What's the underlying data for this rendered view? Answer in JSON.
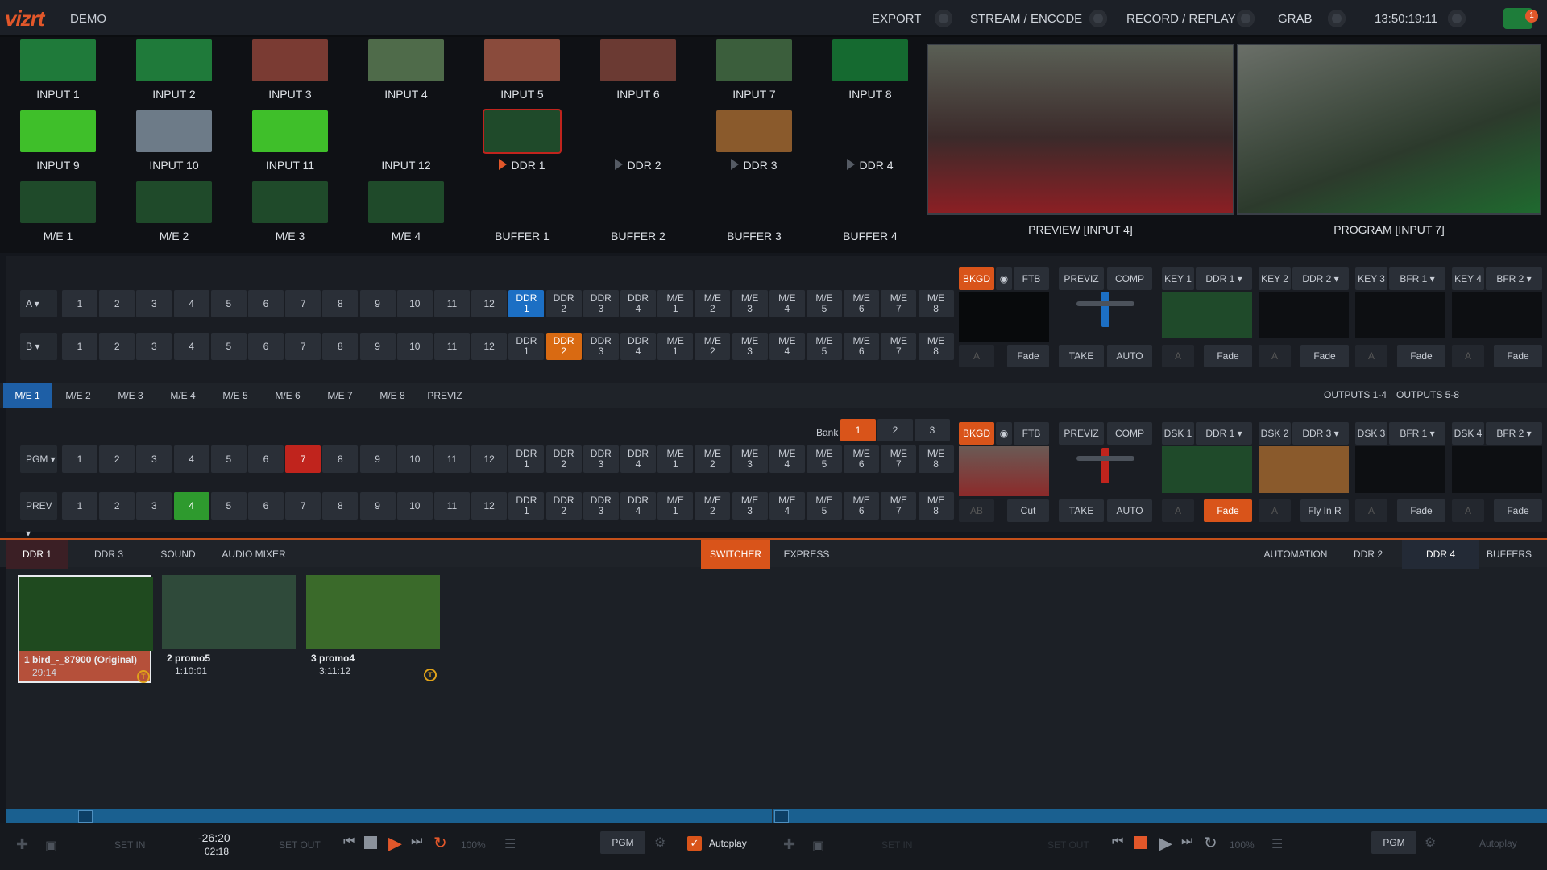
{
  "topbar": {
    "logo": "vizrt",
    "session_name": "DEMO",
    "menu": [
      "EXPORT",
      "STREAM / ENCODE",
      "RECORD / REPLAY",
      "GRAB"
    ],
    "clock": "13:50:19:11",
    "notification_count": "1"
  },
  "sources": [
    {
      "label": "INPUT 1",
      "color": "#1f7a3a"
    },
    {
      "label": "INPUT 2",
      "color": "#1f7a3a"
    },
    {
      "label": "INPUT 3",
      "color": "#7a3b33"
    },
    {
      "label": "INPUT 4",
      "color": "#4f6b4a"
    },
    {
      "label": "INPUT 5",
      "color": "#8a4b3c"
    },
    {
      "label": "INPUT 6",
      "color": "#6b3a33"
    },
    {
      "label": "INPUT 7",
      "color": "#3b5e3c"
    },
    {
      "label": "INPUT 8",
      "color": "#156a30"
    },
    {
      "label": "INPUT 9",
      "color": "#3fbf2a"
    },
    {
      "label": "INPUT 10",
      "color": "#6d7b88"
    },
    {
      "label": "INPUT 11",
      "color": "#3fbf2a"
    },
    {
      "label": "INPUT 12",
      "color": ""
    },
    {
      "label": "DDR 1",
      "color": "#1f4a2a",
      "play": true,
      "active": true
    },
    {
      "label": "DDR 2",
      "color": "",
      "play": true
    },
    {
      "label": "DDR 3",
      "color": "#8a5a2c",
      "play": true
    },
    {
      "label": "DDR 4",
      "color": "",
      "play": true
    },
    {
      "label": "M/E 1",
      "color": "#1f4a2a"
    },
    {
      "label": "M/E 2",
      "color": "#1f4a2a"
    },
    {
      "label": "M/E 3",
      "color": "#1f4a2a"
    },
    {
      "label": "M/E 4",
      "color": "#1f4a2a"
    },
    {
      "label": "BUFFER 1",
      "color": ""
    },
    {
      "label": "BUFFER 2",
      "color": ""
    },
    {
      "label": "BUFFER 3",
      "color": ""
    },
    {
      "label": "BUFFER 4",
      "color": ""
    }
  ],
  "monitors": {
    "preview_label": "PREVIEW [INPUT 4]",
    "program_label": "PROGRAM [INPUT 7]"
  },
  "buttons": [
    "1",
    "2",
    "3",
    "4",
    "5",
    "6",
    "7",
    "8",
    "9",
    "10",
    "11",
    "12",
    "DDR\n1",
    "DDR\n2",
    "DDR\n3",
    "DDR\n4",
    "M/E\n1",
    "M/E\n2",
    "M/E\n3",
    "M/E\n4",
    "M/E\n5",
    "M/E\n6",
    "M/E\n7",
    "M/E\n8"
  ],
  "top_me": {
    "row_a_label": "A",
    "row_b_label": "B",
    "row_a_selected": "DDR 1",
    "row_b_selected": "DDR 2",
    "controls": {
      "bkgd": "BKGD",
      "ftb": "FTB",
      "previz": "PREVIZ",
      "comp": "COMP",
      "take": "TAKE",
      "auto": "AUTO",
      "fade": "Fade"
    },
    "keys": [
      {
        "name": "KEY 1",
        "source": "DDR 1",
        "transition": "Fade"
      },
      {
        "name": "KEY 2",
        "source": "DDR 2",
        "transition": "Fade"
      },
      {
        "name": "KEY 3",
        "source": "BFR 1",
        "transition": "Fade"
      },
      {
        "name": "KEY 4",
        "source": "BFR 2",
        "transition": "Fade"
      }
    ]
  },
  "me_tabs": [
    "M/E 1",
    "M/E 2",
    "M/E 3",
    "M/E 4",
    "M/E 5",
    "M/E 6",
    "M/E 7",
    "M/E 8",
    "PREVIZ"
  ],
  "me_tab_active": "M/E 1",
  "outputs": [
    "OUTPUTS 1-4",
    "OUTPUTS 5-8"
  ],
  "main_switcher": {
    "bank_label": "Bank",
    "banks": [
      "1",
      "2",
      "3"
    ],
    "bank_active": "1",
    "pgm_label": "PGM",
    "prev_label": "PREV",
    "pgm_selected": "7",
    "prev_selected": "4",
    "controls": {
      "bkgd": "BKGD",
      "ftb": "FTB",
      "previz": "PREVIZ",
      "comp": "COMP",
      "take": "TAKE",
      "auto": "AUTO",
      "cut": "Cut"
    },
    "dsks": [
      {
        "name": "DSK 1",
        "source": "DDR 1",
        "transition": "Fade",
        "active": true
      },
      {
        "name": "DSK 2",
        "source": "DDR 3",
        "transition": "Fly In R"
      },
      {
        "name": "DSK 3",
        "source": "BFR 1",
        "transition": "Fade"
      },
      {
        "name": "DSK 4",
        "source": "BFR 2",
        "transition": "Fade"
      }
    ]
  },
  "bottom_tabs_left": [
    "DDR 1",
    "DDR 3",
    "SOUND",
    "AUDIO MIXER"
  ],
  "bottom_tabs_center": [
    "SWITCHER",
    "EXPRESS"
  ],
  "bottom_tabs_right": [
    "AUTOMATION",
    "DDR 2",
    "DDR 4",
    "BUFFERS"
  ],
  "clips": [
    {
      "index": "1",
      "name": "bird_-_87900 (Original)",
      "duration": "29:14",
      "badge": "T",
      "color": "#1f4a1f"
    },
    {
      "index": "2",
      "name": "promo5",
      "duration": "1:10:01",
      "color": "#2f4a3a"
    },
    {
      "index": "3",
      "name": "promo4",
      "duration": "3:11:12",
      "badge": "T",
      "color": "#3a6a2a"
    }
  ],
  "transport_left": {
    "set_in": "SET IN",
    "set_out": "SET OUT",
    "remaining": "-26:20",
    "elapsed": "02:18",
    "speed": "100%",
    "out": "PGM",
    "autoplay": "Autoplay",
    "autoplay_checked": true
  },
  "transport_right": {
    "set_in": "SET IN",
    "set_out": "SET OUT",
    "speed": "100%",
    "out": "PGM",
    "autoplay": "Autoplay"
  }
}
